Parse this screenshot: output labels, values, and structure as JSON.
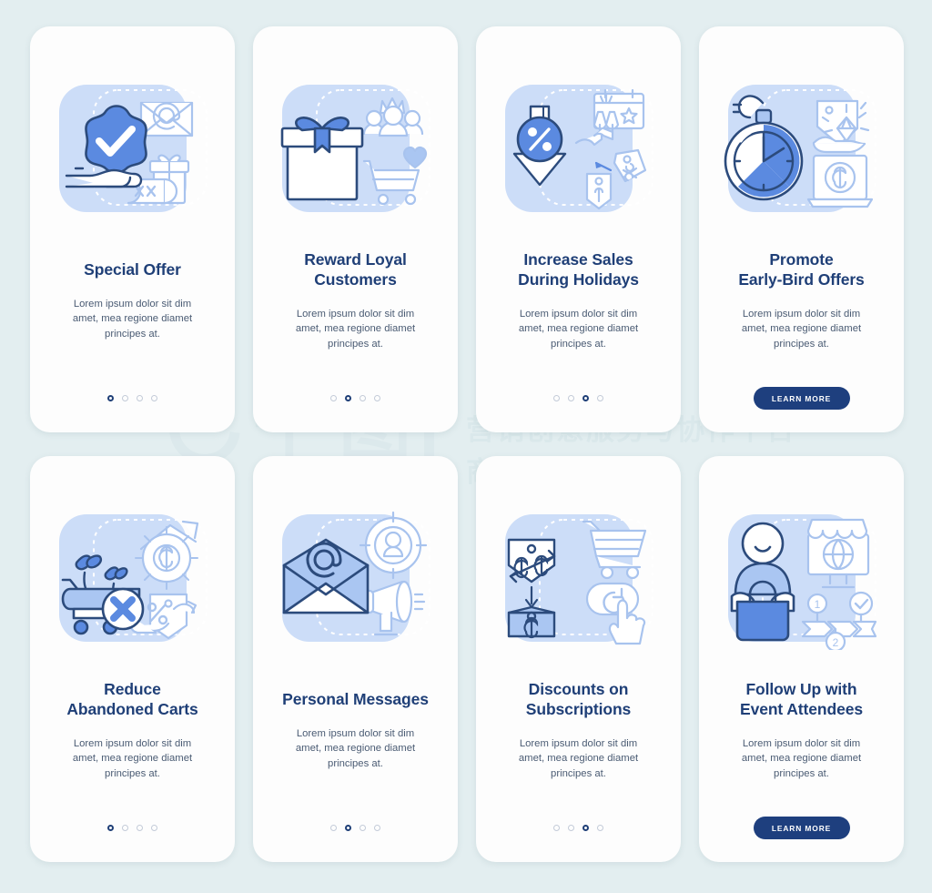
{
  "page": {
    "background_color": "#e3eef0",
    "card_background": "#fdfdfd",
    "accent_dark_blue": "#1f3f77",
    "accent_blue": "#5b8ae0",
    "illustration_bg": "#ccddf8"
  },
  "watermark": {
    "logo_qian": "千",
    "logo_tu": "图",
    "line1": "营销创意服务与协作平台",
    "line2": "商用请获取授权"
  },
  "screens": [
    {
      "id": "special-offer",
      "illustration": "hand-holding-star-check-envelope-gift",
      "title": "Special Offer",
      "title_lines": [
        "Special Offer"
      ],
      "body": "Lorem ipsum dolor sit dim amet, mea regione diamet principes at.",
      "footer_type": "dots",
      "dots": {
        "count": 4,
        "active_index": 0
      }
    },
    {
      "id": "reward-loyal-customers",
      "illustration": "gift-box-crown-people-cart-heart",
      "title": "Reward Loyal Customers",
      "title_lines": [
        "Reward Loyal",
        "Customers"
      ],
      "body": "Lorem ipsum dolor sit dim amet, mea regione diamet principes at.",
      "footer_type": "dots",
      "dots": {
        "count": 4,
        "active_index": 1
      }
    },
    {
      "id": "increase-sales-during-holidays",
      "illustration": "percent-arrow-down-calendar-cheers-price-tags",
      "title": "Increase Sales During Holidays",
      "title_lines": [
        "Increase Sales",
        "During Holidays"
      ],
      "body": "Lorem ipsum dolor sit dim amet, mea regione diamet principes at.",
      "footer_type": "dots",
      "dots": {
        "count": 4,
        "active_index": 2
      }
    },
    {
      "id": "promote-early-bird-offers",
      "illustration": "stopwatch-diamond-tag-laptop-dollar",
      "title": "Promote Early-Bird Offers",
      "title_lines": [
        "Promote",
        "Early-Bird Offers"
      ],
      "body": "Lorem ipsum dolor sit dim amet, mea regione diamet principes at.",
      "footer_type": "button",
      "button_label": "LEARN MORE"
    },
    {
      "id": "reduce-abandoned-carts",
      "illustration": "cart-cross-sprouts-dollar-gear-arrow-percent-tag",
      "title": "Reduce Abandoned Carts",
      "title_lines": [
        "Reduce",
        "Abandoned Carts"
      ],
      "body": "Lorem ipsum dolor sit dim amet, mea regione diamet principes at.",
      "footer_type": "dots",
      "dots": {
        "count": 4,
        "active_index": 0
      }
    },
    {
      "id": "personal-messages",
      "illustration": "email-at-target-user-megaphone",
      "title": "Personal Messages",
      "title_lines": [
        "Personal Messages"
      ],
      "body": "Lorem ipsum dolor sit dim amet, mea regione diamet principes at.",
      "footer_type": "dots",
      "dots": {
        "count": 4,
        "active_index": 1
      }
    },
    {
      "id": "discounts-on-subscriptions",
      "illustration": "price-tags-discount-cart-refresh-hand",
      "title": "Discounts on Subscriptions",
      "title_lines": [
        "Discounts on",
        "Subscriptions"
      ],
      "body": "Lorem ipsum dolor sit dim amet, mea regione diamet principes at.",
      "footer_type": "dots",
      "dots": {
        "count": 4,
        "active_index": 2
      }
    },
    {
      "id": "follow-up-with-event-attendees",
      "illustration": "person-bag-store-globe-steps-check",
      "title": "Follow Up with Event Attendees",
      "title_lines": [
        "Follow Up with",
        "Event Attendees"
      ],
      "body": "Lorem ipsum dolor sit dim amet, mea regione diamet principes at.",
      "footer_type": "button",
      "button_label": "LEARN MORE"
    }
  ]
}
